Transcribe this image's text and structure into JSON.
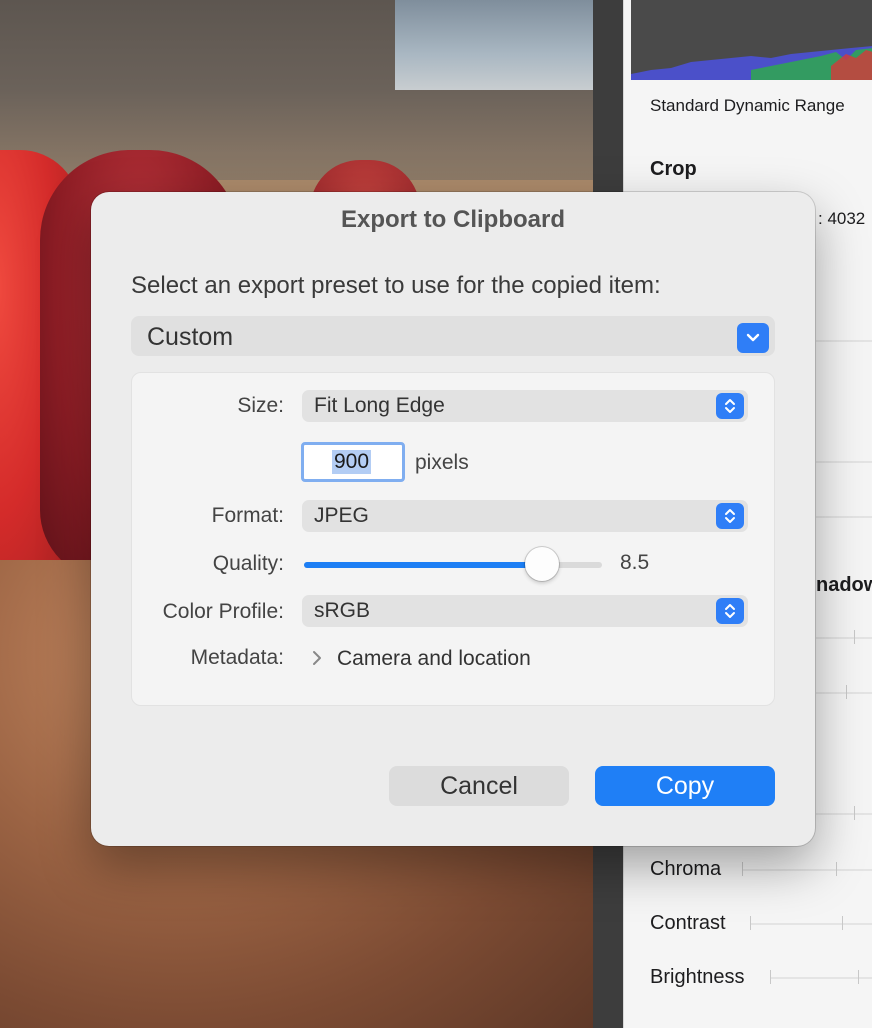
{
  "sidebar": {
    "dynamic_range": "Standard Dynamic Range",
    "crop_heading": "Crop",
    "crop_value_partial": ": 4032",
    "shadows_partial": "nadow",
    "adjustments": [
      {
        "label": "Chroma"
      },
      {
        "label": "Contrast"
      },
      {
        "label": "Brightness"
      }
    ]
  },
  "dialog": {
    "title": "Export to Clipboard",
    "prompt": "Select an export preset to use for the copied item:",
    "preset": "Custom",
    "size_label": "Size:",
    "size_value": "Fit Long Edge",
    "pixels_value": "900",
    "pixels_unit": "pixels",
    "format_label": "Format:",
    "format_value": "JPEG",
    "quality_label": "Quality:",
    "quality_value": "8.5",
    "quality_fraction": 0.8,
    "color_profile_label": "Color Profile:",
    "color_profile_value": "sRGB",
    "metadata_label": "Metadata:",
    "metadata_value": "Camera and location",
    "cancel_label": "Cancel",
    "copy_label": "Copy"
  },
  "colors": {
    "accent": "#1f7ff6",
    "dialog_bg": "#ececec"
  }
}
